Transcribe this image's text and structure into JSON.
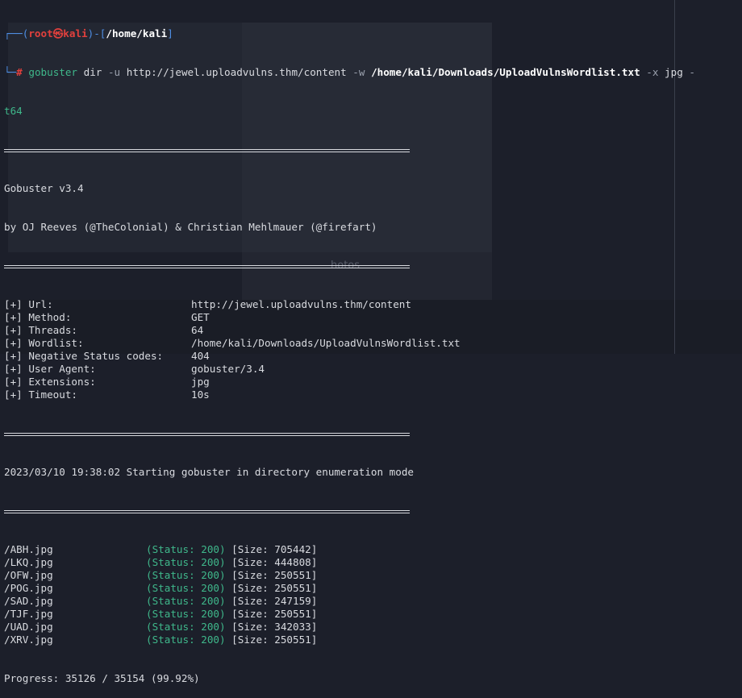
{
  "prompt": {
    "user": "root",
    "host": "kali",
    "cwd": "/home/kali",
    "symbol": "#"
  },
  "command": {
    "tool": "gobuster",
    "mode": "dir",
    "flag_u": "-u",
    "url": "http://jewel.uploadvulns.thm/content",
    "flag_w": "-w",
    "wordlist": "/home/kali/Downloads/UploadVulnsWordlist.txt",
    "flag_x": "-x",
    "ext": "jpg",
    "flag_t": "-",
    "t_cont": "t64"
  },
  "banner": {
    "version": "Gobuster v3.4",
    "authors": "by OJ Reeves (@TheColonial) & Christian Mehlmauer (@firefart)"
  },
  "config": [
    {
      "key": "[+] Url:",
      "value": "http://jewel.uploadvulns.thm/content"
    },
    {
      "key": "[+] Method:",
      "value": "GET"
    },
    {
      "key": "[+] Threads:",
      "value": "64"
    },
    {
      "key": "[+] Wordlist:",
      "value": "/home/kali/Downloads/UploadVulnsWordlist.txt"
    },
    {
      "key": "[+] Negative Status codes:",
      "value": "404"
    },
    {
      "key": "[+] User Agent:",
      "value": "gobuster/3.4"
    },
    {
      "key": "[+] Extensions:",
      "value": "jpg"
    },
    {
      "key": "[+] Timeout:",
      "value": "10s"
    }
  ],
  "start_line": "2023/03/10 19:38:02 Starting gobuster in directory enumeration mode",
  "results": [
    {
      "path": "/ABH.jpg",
      "status": "(Status: 200)",
      "size": "[Size: 705442]"
    },
    {
      "path": "/LKQ.jpg",
      "status": "(Status: 200)",
      "size": "[Size: 444808]"
    },
    {
      "path": "/OFW.jpg",
      "status": "(Status: 200)",
      "size": "[Size: 250551]"
    },
    {
      "path": "/POG.jpg",
      "status": "(Status: 200)",
      "size": "[Size: 250551]"
    },
    {
      "path": "/SAD.jpg",
      "status": "(Status: 200)",
      "size": "[Size: 247159]"
    },
    {
      "path": "/TJF.jpg",
      "status": "(Status: 200)",
      "size": "[Size: 250551]"
    },
    {
      "path": "/UAD.jpg",
      "status": "(Status: 200)",
      "size": "[Size: 342033]"
    },
    {
      "path": "/XRV.jpg",
      "status": "(Status: 200)",
      "size": "[Size: 250551]"
    }
  ],
  "progress": "Progress: 35126 / 35154 (99.92%)",
  "background_text": "hotos"
}
